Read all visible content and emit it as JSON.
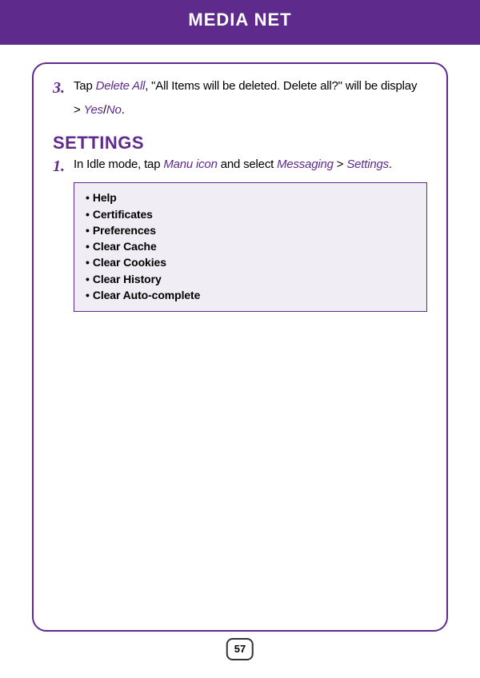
{
  "header": {
    "title": "MEDIA NET"
  },
  "step3": {
    "num": "3.",
    "t1": "Tap ",
    "link1": "Delete All",
    "t2": ", \"All Items will be deleted. Delete all?\" will be display",
    "cont1": "> ",
    "link2": "Yes",
    "slash": "/",
    "link3": "No",
    "t3": "."
  },
  "section": {
    "heading": "SETTINGS"
  },
  "step1": {
    "num": "1.",
    "t1": "In Idle mode, tap ",
    "link1": "Manu icon",
    "t2": " and select ",
    "link2": "Messaging",
    "t3": " > ",
    "link3": "Settings",
    "t4": "."
  },
  "options": {
    "items": [
      "Help",
      "Certificates",
      "Preferences",
      "Clear Cache",
      "Clear Cookies",
      "Clear History",
      "Clear Auto-complete"
    ]
  },
  "page": {
    "number": "57"
  }
}
